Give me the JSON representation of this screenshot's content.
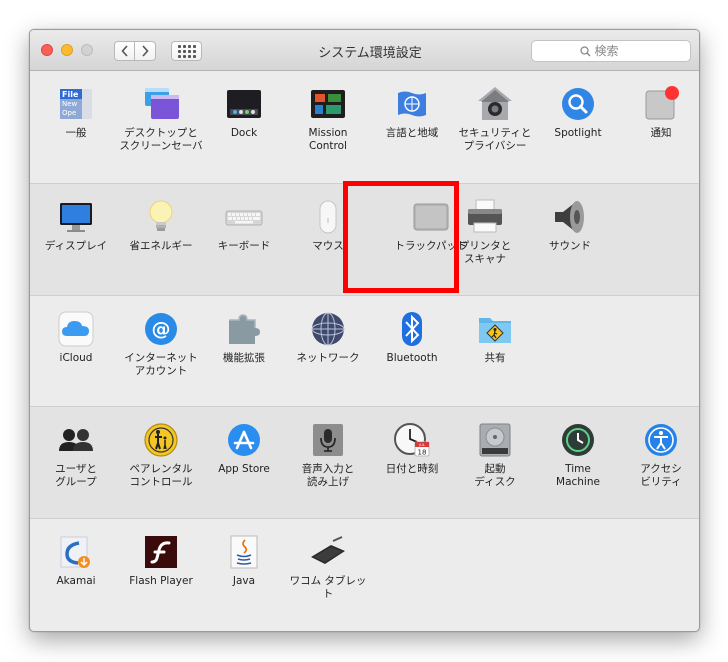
{
  "window": {
    "title": "システム環境設定",
    "search_placeholder": "検索"
  },
  "sections": [
    {
      "name": "personal",
      "items": [
        {
          "label": "一般",
          "icon": "general-icon"
        },
        {
          "label": "デスクトップと\nスクリーンセーバ",
          "icon": "desktop-screensaver-icon"
        },
        {
          "label": "Dock",
          "icon": "dock-icon"
        },
        {
          "label": "Mission\nControl",
          "icon": "mission-control-icon"
        },
        {
          "label": "言語と地域",
          "icon": "language-region-icon"
        },
        {
          "label": "セキュリティと\nプライバシー",
          "icon": "security-privacy-icon"
        },
        {
          "label": "Spotlight",
          "icon": "spotlight-icon"
        },
        {
          "label": "通知",
          "icon": "notifications-icon"
        }
      ]
    },
    {
      "name": "hardware",
      "items": [
        {
          "label": "ディスプレイ",
          "icon": "displays-icon"
        },
        {
          "label": "省エネルギー",
          "icon": "energy-saver-icon"
        },
        {
          "label": "キーボード",
          "icon": "keyboard-icon"
        },
        {
          "label": "マウス",
          "icon": "mouse-icon"
        },
        {
          "label": "トラックパッド",
          "icon": "trackpad-icon"
        },
        {
          "label": "プリンタと\nスキャナ",
          "icon": "printers-scanners-icon"
        },
        {
          "label": "サウンド",
          "icon": "sound-icon"
        }
      ]
    },
    {
      "name": "internet",
      "items": [
        {
          "label": "iCloud",
          "icon": "icloud-icon"
        },
        {
          "label": "インターネット\nアカウント",
          "icon": "internet-accounts-icon"
        },
        {
          "label": "機能拡張",
          "icon": "extensions-icon"
        },
        {
          "label": "ネットワーク",
          "icon": "network-icon"
        },
        {
          "label": "Bluetooth",
          "icon": "bluetooth-icon"
        },
        {
          "label": "共有",
          "icon": "sharing-icon"
        }
      ]
    },
    {
      "name": "system",
      "items": [
        {
          "label": "ユーザと\nグループ",
          "icon": "users-groups-icon"
        },
        {
          "label": "ペアレンタル\nコントロール",
          "icon": "parental-controls-icon"
        },
        {
          "label": "App Store",
          "icon": "app-store-icon"
        },
        {
          "label": "音声入力と\n読み上げ",
          "icon": "dictation-speech-icon"
        },
        {
          "label": "日付と時刻",
          "icon": "date-time-icon"
        },
        {
          "label": "起動\nディスク",
          "icon": "startup-disk-icon"
        },
        {
          "label": "Time\nMachine",
          "icon": "time-machine-icon"
        },
        {
          "label": "アクセシ\nビリティ",
          "icon": "accessibility-icon"
        }
      ]
    },
    {
      "name": "other",
      "items": [
        {
          "label": "Akamai",
          "icon": "akamai-icon"
        },
        {
          "label": "Flash Player",
          "icon": "flash-player-icon"
        },
        {
          "label": "Java",
          "icon": "java-icon"
        },
        {
          "label": "ワコム タブレット",
          "icon": "wacom-tablet-icon"
        }
      ]
    }
  ],
  "icon_text": {
    "general": [
      "File",
      "New",
      "Ope"
    ],
    "calendar_month": "JUL",
    "calendar_day": "18"
  },
  "highlight": {
    "target": "トラックパッド",
    "color": "#ff0000"
  }
}
